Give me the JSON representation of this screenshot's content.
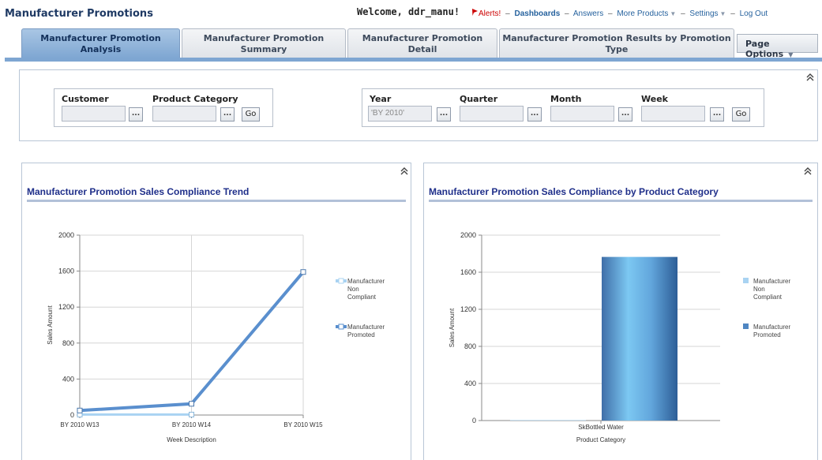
{
  "header": {
    "app_title": "Manufacturer Promotions",
    "welcome": "Welcome, ddr_manu!",
    "alerts_label": "Alerts!",
    "dashboards_label": "Dashboards",
    "answers_label": "Answers",
    "more_products_label": "More Products",
    "settings_label": "Settings",
    "logout_label": "Log Out",
    "separator": "–"
  },
  "tabs": [
    {
      "line1": "Manufacturer Promotion",
      "line2": "Analysis",
      "active": true
    },
    {
      "line1": "Manufacturer Promotion",
      "line2": "Summary",
      "active": false
    },
    {
      "line1": "Manufacturer Promotion",
      "line2": "Detail",
      "active": false
    },
    {
      "line1": "Manufacturer Promotion Results by Promotion",
      "line2": "Type",
      "active": false
    }
  ],
  "page_options_label": "Page Options",
  "prompts": {
    "customer_label": "Customer",
    "product_category_label": "Product Category",
    "year_label": "Year",
    "quarter_label": "Quarter",
    "month_label": "Month",
    "week_label": "Week",
    "year_value": "'BY 2010'",
    "browse_label": "...",
    "go_label": "Go"
  },
  "left_chart": {
    "title": "Manufacturer Promotion Sales Compliance Trend",
    "chart_data": {
      "type": "line",
      "categories": [
        "BY 2010 W13",
        "BY 2010 W14",
        "BY 2010 W15"
      ],
      "series": [
        {
          "name": "Manufacturer Non Compliant",
          "values": [
            5,
            5,
            null
          ],
          "color": "#a9d3f2"
        },
        {
          "name": "Manufacturer Promoted",
          "values": [
            50,
            125,
            1590
          ],
          "color": "#5a8fce"
        }
      ],
      "xlabel": "Week Description",
      "ylabel": "Sales Amount",
      "ylim": [
        0,
        2000
      ],
      "yticks": [
        0,
        400,
        800,
        1200,
        1600,
        2000
      ],
      "legend": [
        "Manufacturer",
        "Non",
        "Compliant",
        "Manufacturer",
        "Promoted"
      ],
      "grid": true,
      "legend_position": "right"
    }
  },
  "right_chart": {
    "title": "Manufacturer Promotion Sales Compliance by Product Category",
    "chart_data": {
      "type": "bar",
      "categories": [
        "SkBottled Water"
      ],
      "series": [
        {
          "name": "Manufacturer Non Compliant",
          "values": [
            5
          ],
          "color": "#a9d3f2"
        },
        {
          "name": "Manufacturer Promoted",
          "values": [
            1765
          ],
          "color": "#4f86c2"
        }
      ],
      "xlabel": "Product Category",
      "ylabel": "Sales Amount",
      "ylim": [
        0,
        2000
      ],
      "yticks": [
        0,
        400,
        800,
        1200,
        1600,
        2000
      ],
      "legend": [
        "Manufacturer",
        "Non",
        "Compliant",
        "Manufacturer",
        "Promoted"
      ],
      "grid": true,
      "legend_position": "right"
    }
  },
  "colors": {
    "accent": "#7ea6d2",
    "title_blue": "#1f2f8a",
    "alert_red": "#cc0000",
    "link_blue": "#26629e"
  },
  "icons": {
    "collapse": "double-chevron-up-icon",
    "alert": "flag-icon",
    "dropdown": "triangle-down-icon"
  }
}
